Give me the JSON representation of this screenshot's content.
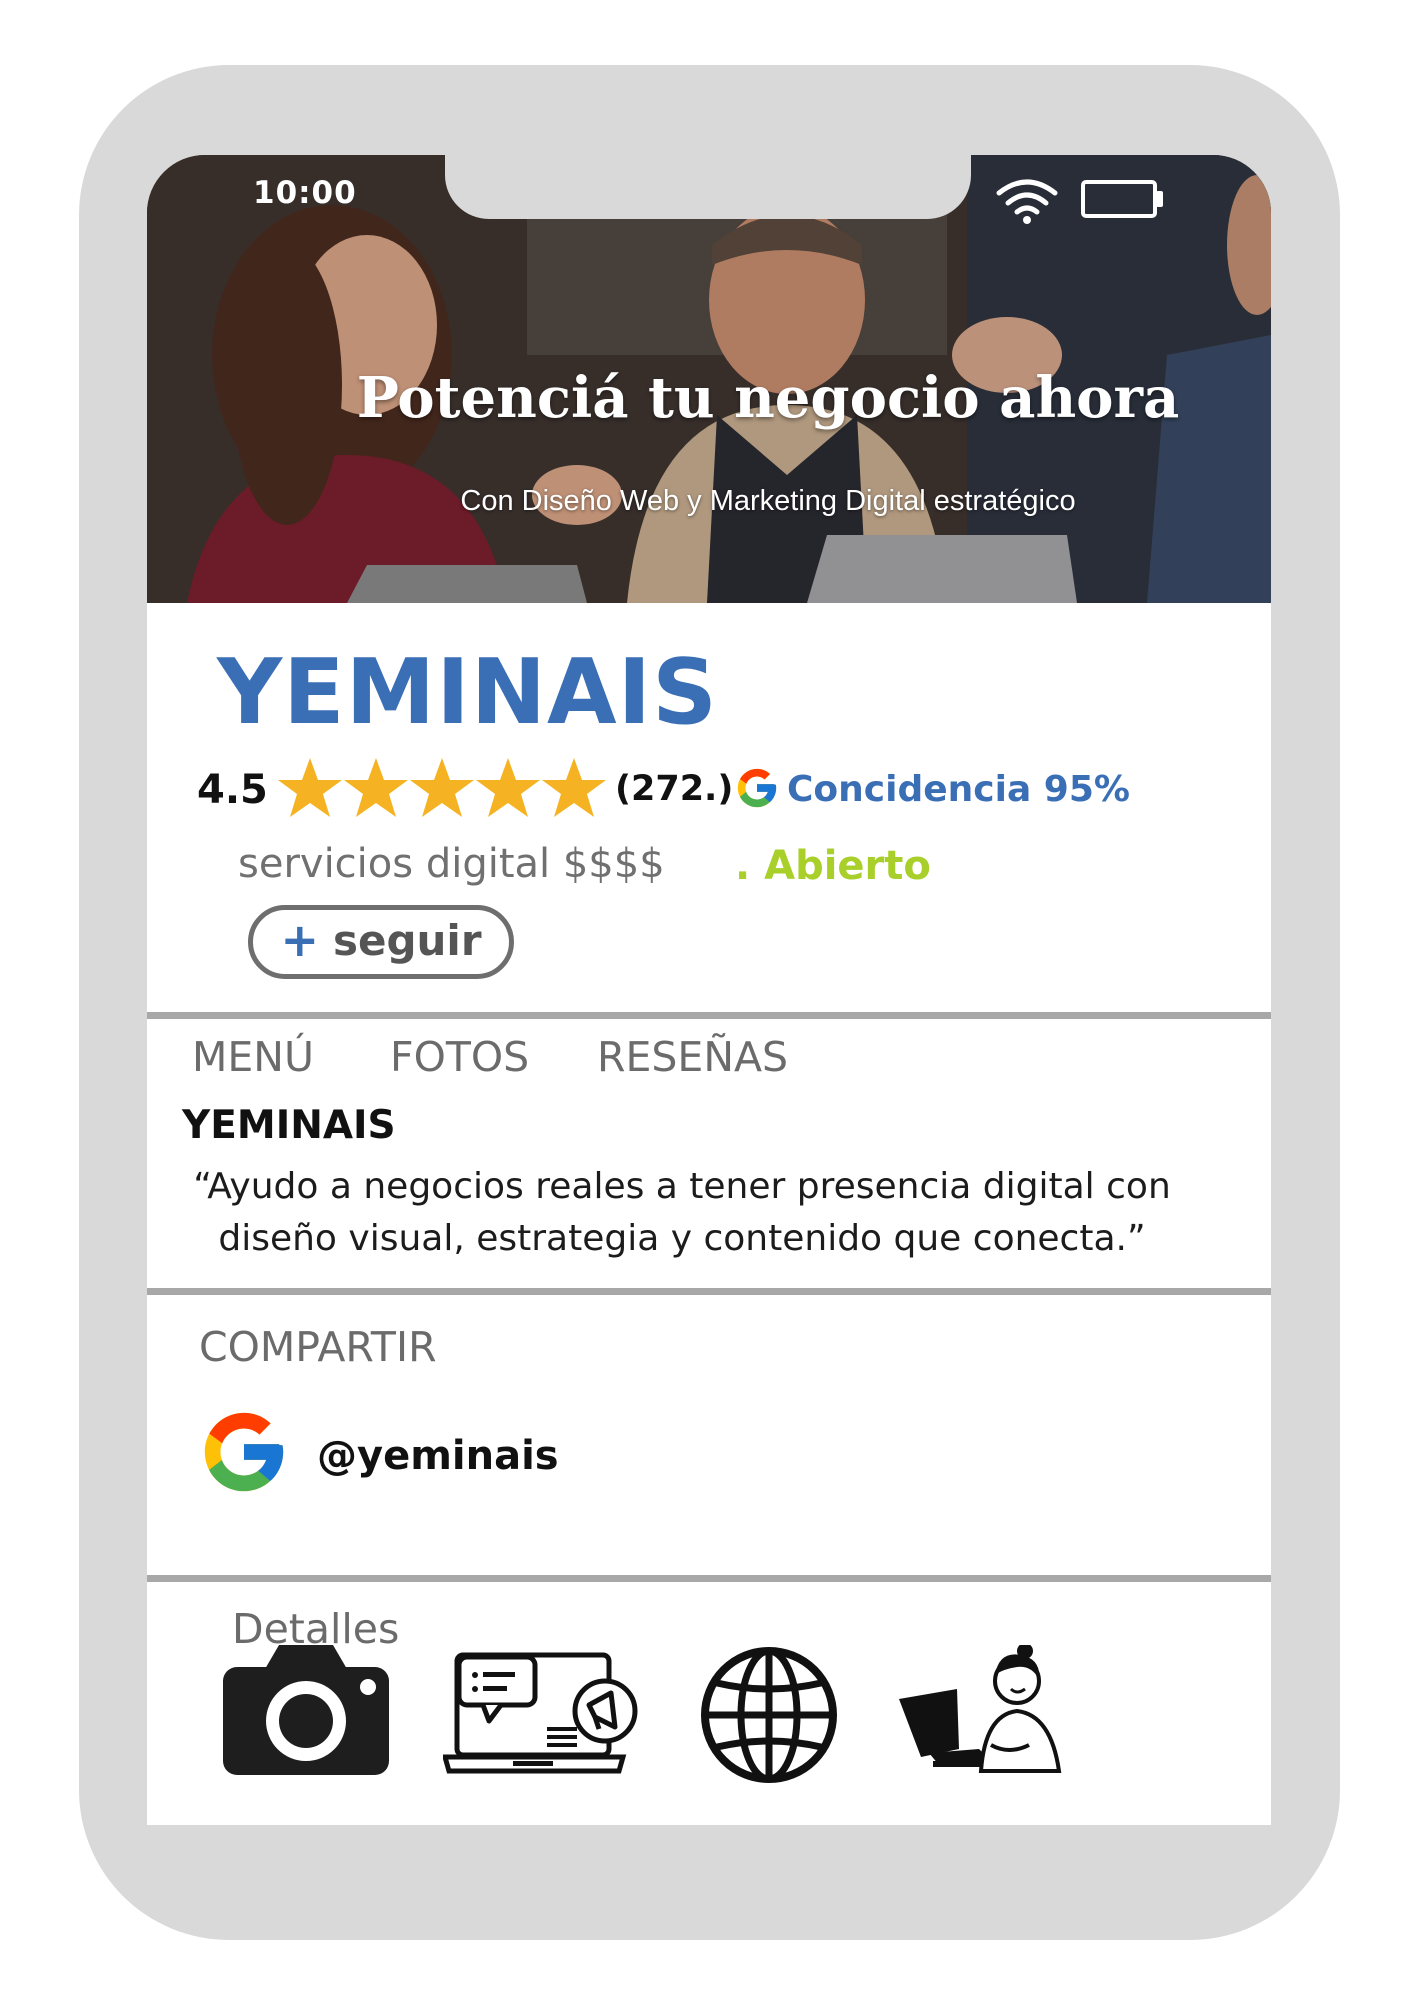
{
  "status_bar": {
    "time": "10:00",
    "wifi_icon": "wifi-icon",
    "battery_icon": "battery-icon"
  },
  "hero": {
    "title": "Potenciá tu negocio ahora",
    "subtitle": "Con Diseño Web y Marketing Digital estratégico"
  },
  "business": {
    "name": "YEMINAIS",
    "rating": "4.5",
    "stars_shown": 5,
    "review_count": "(272.)",
    "match_label": "Concidencia 95%",
    "category": "servicios digital $$$$",
    "open_status": ". Abierto",
    "follow_plus": "+",
    "follow_label": "seguir"
  },
  "tabs": [
    {
      "label": "MENÚ"
    },
    {
      "label": "FOTOS"
    },
    {
      "label": "RESEÑAS"
    }
  ],
  "about": {
    "title": "YEMINAIS",
    "quote": "“Ayudo a negocios reales a tener presencia digital con diseño visual, estrategia y contenido que conecta.”"
  },
  "share": {
    "title": "COMPARTIR",
    "icon": "google-icon",
    "handle": "@yeminais"
  },
  "details": {
    "title": "Detalles",
    "icons": [
      "camera-icon",
      "laptop-marketing-icon",
      "globe-icon",
      "woman-at-computer-icon"
    ]
  },
  "colors": {
    "brand_blue": "#3a6fb6",
    "star_gold": "#f5b323",
    "open_green": "#a8cf2a",
    "frame_gray": "#d9d9d9",
    "divider_gray": "#a8a8a8"
  }
}
